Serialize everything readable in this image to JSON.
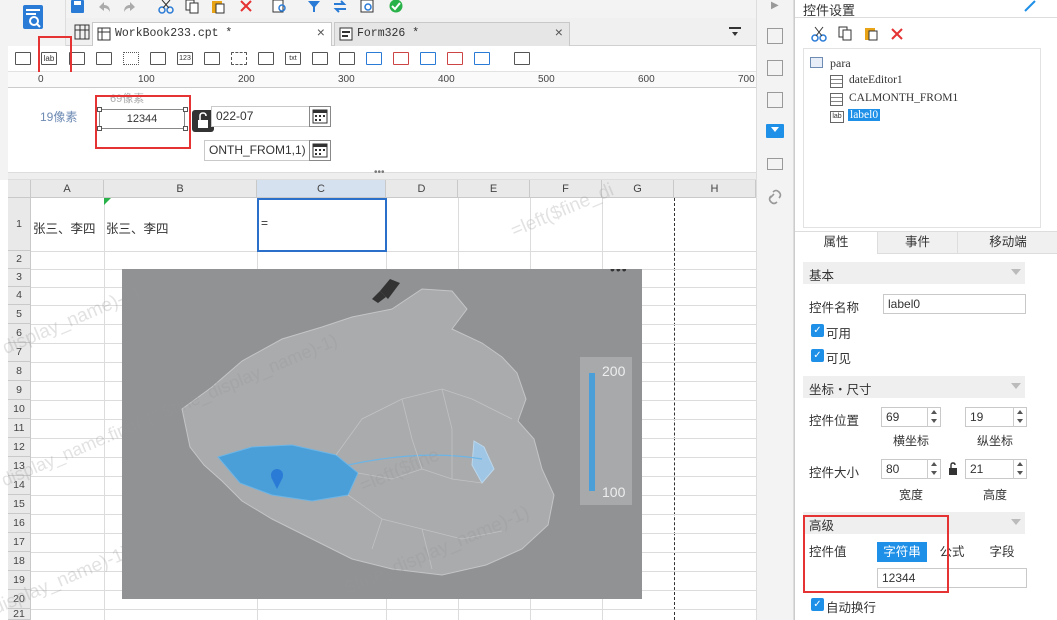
{
  "editor": {
    "tabs": [
      {
        "label": "WorkBook233.cpt *",
        "active": true
      },
      {
        "label": "Form326 *",
        "active": false
      }
    ],
    "ruler_ticks": [
      "0",
      "100",
      "200",
      "300",
      "400",
      "500",
      "600",
      "700"
    ],
    "params": {
      "row_label": "19像素",
      "above_label": "69像素",
      "label_widget_value": "12344",
      "date_value": "022-07",
      "formula_value": "ONTH_FROM1,1)"
    }
  },
  "sheet": {
    "columns": [
      "A",
      "B",
      "C",
      "D",
      "E",
      "F",
      "G",
      "H"
    ],
    "rows": [
      "1",
      "2",
      "3",
      "4",
      "5",
      "6",
      "7",
      "8",
      "9",
      "10",
      "11",
      "12",
      "13",
      "14",
      "15",
      "16",
      "17",
      "18",
      "19",
      "20",
      "21"
    ],
    "cells": {
      "A1": "张三、李四",
      "B1": "张三、李四",
      "C1": "="
    },
    "watermark": [
      "=left($fine_di",
      "display_name)-1)",
      "display_name.find(\"(\",$fine_display_name)-1)",
      "display_name)-1)",
      "=left($fine",
      "$fine_display_name)-1)"
    ]
  },
  "map": {
    "legend_max": "200",
    "legend_min": "100",
    "more_label": "•••"
  },
  "panel": {
    "title": "控件设置",
    "tree": {
      "root": "para",
      "children": [
        "dateEditor1",
        "CALMONTH_FROM1",
        "label0"
      ],
      "selected": "label0"
    },
    "tabs": [
      "属性",
      "事件",
      "移动端"
    ],
    "sections": {
      "basic": "基本",
      "coords": "坐标・尺寸",
      "advanced": "高级"
    },
    "name_label": "控件名称",
    "name_value": "label0",
    "enabled_label": "可用",
    "visible_label": "可见",
    "pos_label": "控件位置",
    "pos_x": "69",
    "pos_y": "19",
    "x_label": "横坐标",
    "y_label": "纵坐标",
    "size_label": "控件大小",
    "width": "80",
    "height": "21",
    "w_label": "宽度",
    "h_label": "高度",
    "value_label": "控件值",
    "value_types": [
      "字符串",
      "公式",
      "字段"
    ],
    "value": "12344",
    "autowrap_label": "自动换行"
  },
  "colors": {
    "accent": "#1e90e8",
    "highlight": "#e53232",
    "map_gray": "#888a8c",
    "map_blue": "#4a9fd8"
  },
  "icons": [
    "save-icon",
    "undo-icon",
    "redo-icon",
    "cut-icon",
    "copy-icon",
    "paste-icon",
    "delete-icon",
    "preview-icon",
    "lock-open-icon",
    "calendar-icon",
    "edit-pencil-icon",
    "link-icon"
  ]
}
